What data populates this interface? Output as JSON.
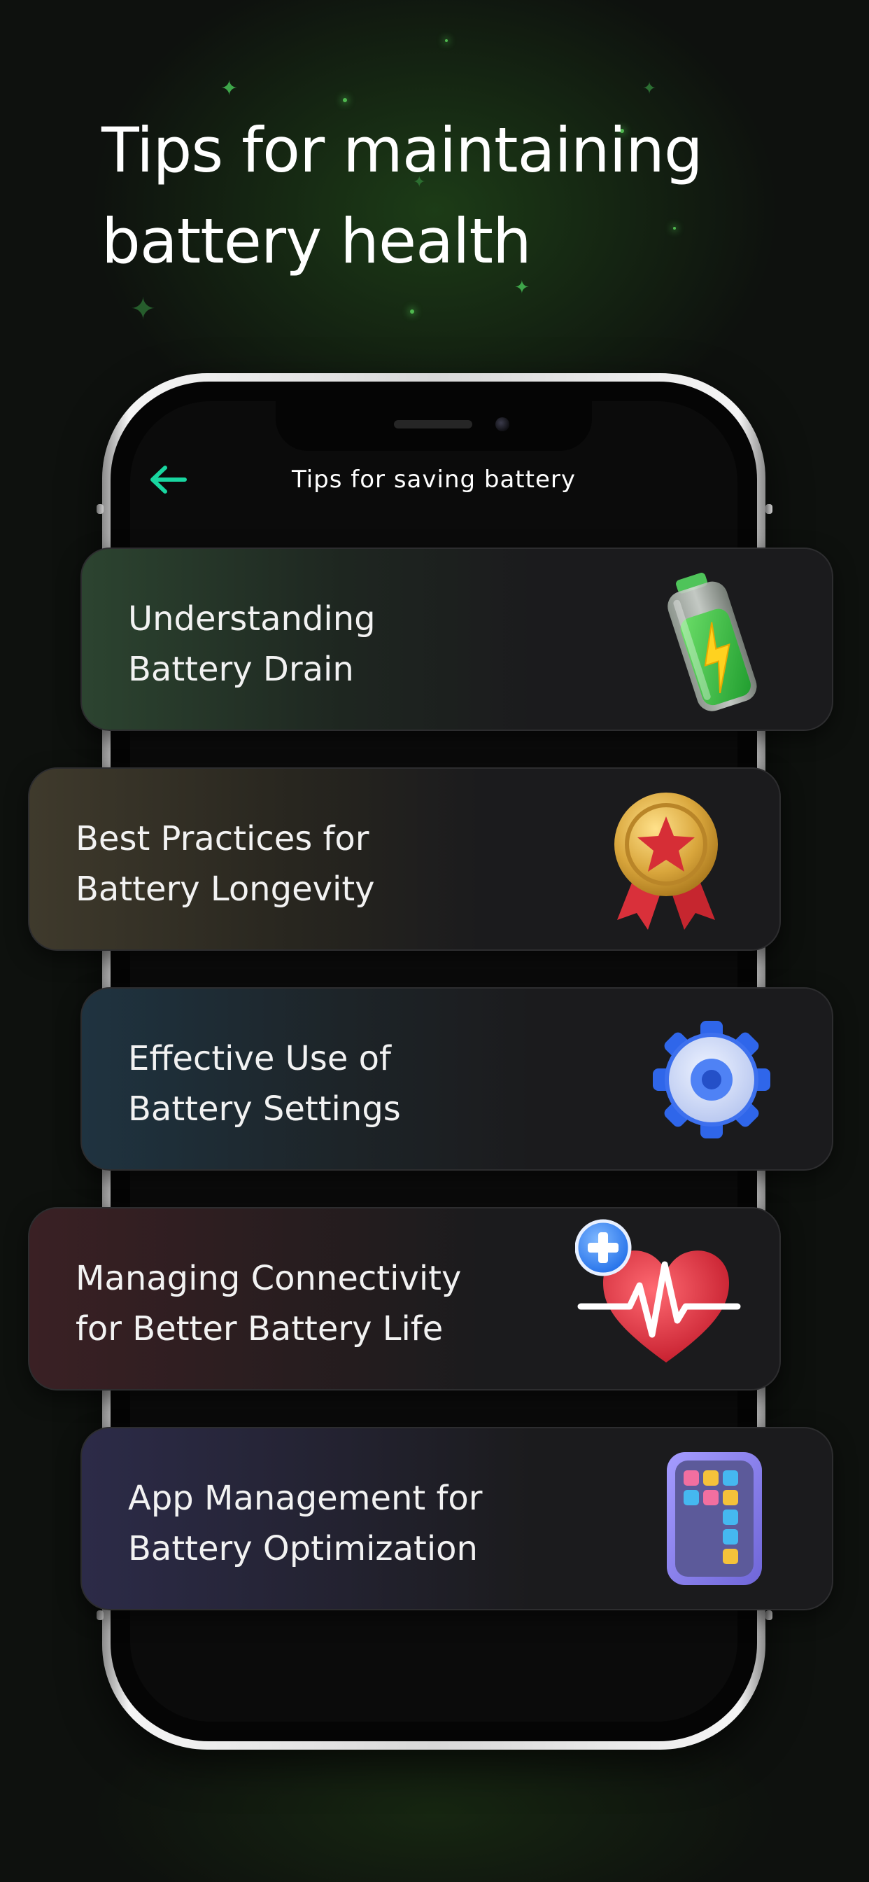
{
  "headline": {
    "line1": "Tips for maintaining",
    "line2": "battery health"
  },
  "screen": {
    "title": "Tips for saving battery",
    "back_icon": "arrow-left-icon"
  },
  "tips": [
    {
      "line1": "Understanding",
      "line2": "Battery Drain",
      "icon": "battery-icon"
    },
    {
      "line1": "Best Practices for",
      "line2": "Battery Longevity",
      "icon": "medal-icon"
    },
    {
      "line1": "Effective Use of",
      "line2": "Battery Settings",
      "icon": "gear-icon"
    },
    {
      "line1": "Managing Connectivity",
      "line2": "for Better Battery Life",
      "icon": "heart-pulse-icon"
    },
    {
      "line1": "App Management for",
      "line2": "Battery Optimization",
      "icon": "phone-apps-icon"
    }
  ],
  "colors": {
    "accent": "#19d6a0",
    "background": "#0e110e",
    "card": "#1b1b1d"
  }
}
